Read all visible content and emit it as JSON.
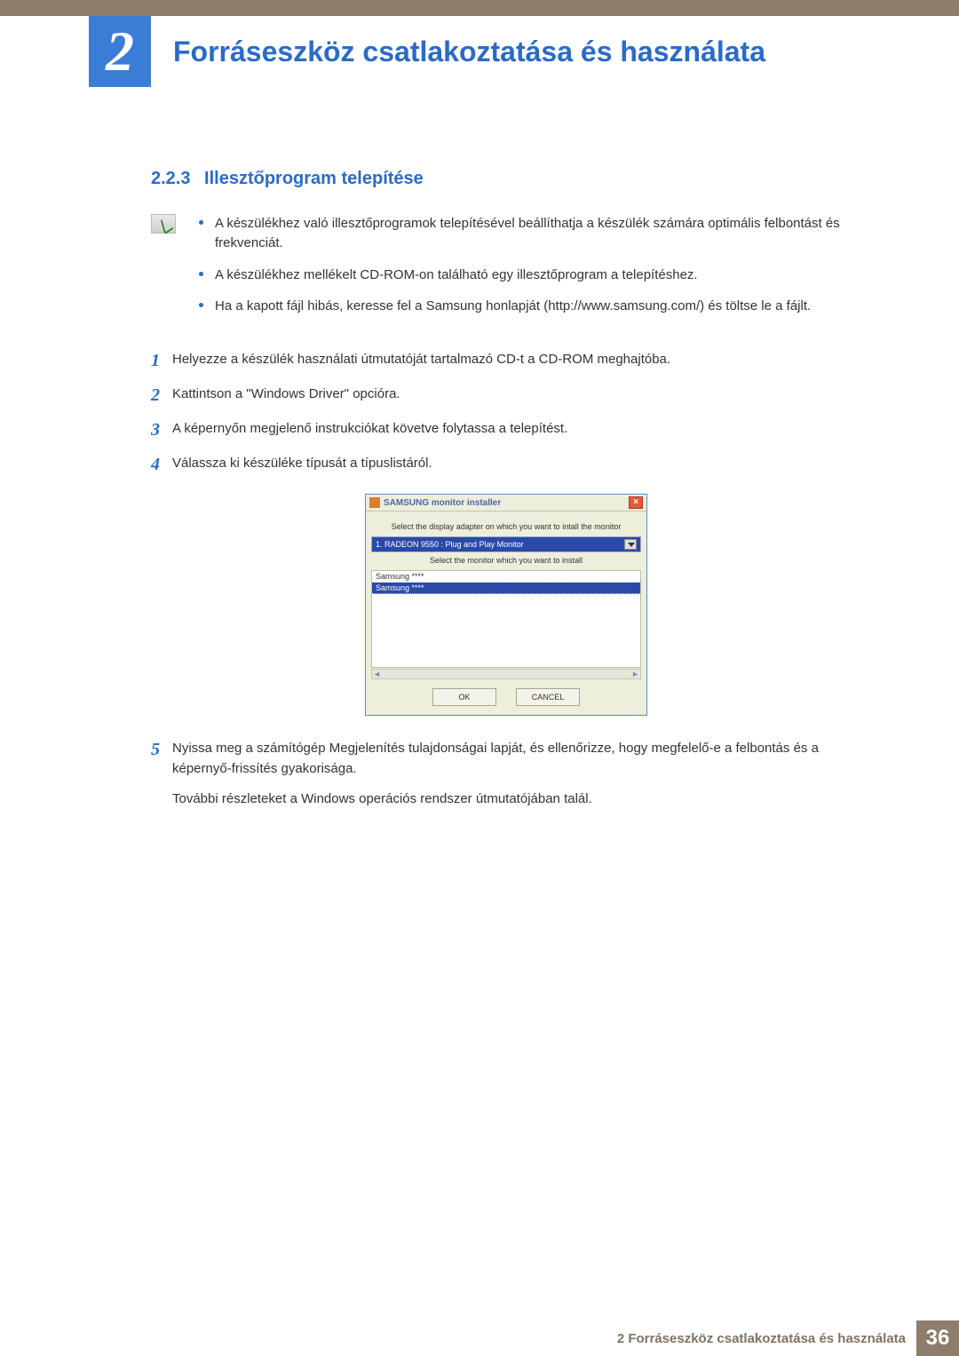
{
  "chapter": {
    "number": "2",
    "title": "Forráseszköz csatlakoztatása és használata"
  },
  "section": {
    "number": "2.2.3",
    "title": "Illesztőprogram telepítése"
  },
  "notes": [
    "A készülékhez való illesztőprogramok telepítésével beállíthatja a készülék számára optimális felbontást és frekvenciát.",
    "A készülékhez mellékelt CD-ROM-on található egy illesztőprogram a telepítéshez.",
    "Ha a kapott fájl hibás, keresse fel a Samsung honlapját (http://www.samsung.com/) és töltse le a fájlt."
  ],
  "steps": [
    "Helyezze a készülék használati útmutatóját tartalmazó CD-t a CD-ROM meghajtóba.",
    "Kattintson a \"Windows Driver\" opcióra.",
    "A képernyőn megjelenő instrukciókat követve folytassa a telepítést.",
    "Válassza ki készüléke típusát a típuslistáról."
  ],
  "dialog": {
    "title": "SAMSUNG monitor installer",
    "prompt1": "Select the display adapter on which you want to intall the monitor",
    "select_value": "1. RADEON 9550 : Plug and Play Monitor",
    "prompt2": "Select the monitor which you want to install",
    "list": [
      "Samsung ****",
      "Samsung ****"
    ],
    "ok": "OK",
    "cancel": "CANCEL"
  },
  "step5": {
    "num": "5",
    "text": "Nyissa meg a számítógép Megjelenítés tulajdonságai lapját, és ellenőrizze, hogy megfelelő-e a felbontás és a képernyő-frissítés gyakorisága.",
    "extra": "További részleteket a Windows operációs rendszer útmutatójában talál."
  },
  "footer": {
    "text": "2 Forráseszköz csatlakoztatása és használata",
    "page": "36"
  }
}
